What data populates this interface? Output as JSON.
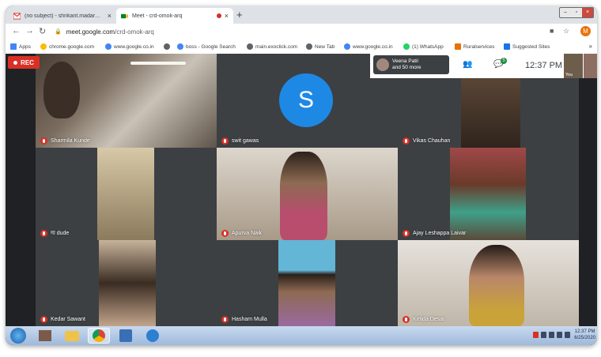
{
  "browser": {
    "tabs": [
      {
        "title": "(no subject) - shrikant.madar@...",
        "active": false
      },
      {
        "title": "Meet - crd-omok-arq",
        "active": true
      }
    ],
    "url_host": "meet.google.com",
    "url_path": "/crd-omok-arq",
    "bookmarks": [
      {
        "label": "Apps",
        "icon": "apps-grid-icon"
      },
      {
        "label": "chrome.google.com",
        "icon": "google-icon"
      },
      {
        "label": "www.google.co.in",
        "icon": "google-icon"
      },
      {
        "label": "",
        "icon": "globe-icon"
      },
      {
        "label": "boss - Google Search",
        "icon": "google-icon"
      },
      {
        "label": "main.exoclick.com",
        "icon": "globe-icon"
      },
      {
        "label": "New Tab",
        "icon": "globe-icon"
      },
      {
        "label": "www.google.co.in",
        "icon": "google-icon"
      },
      {
        "label": "(1) WhatsApp",
        "icon": "whatsapp-icon"
      },
      {
        "label": "Ruralservices",
        "icon": "bookmark-icon"
      },
      {
        "label": "Suggested Sites",
        "icon": "bookmark-icon"
      }
    ],
    "profile_initial": "M"
  },
  "meet": {
    "rec_label": "REC",
    "presenter_name": "Veena Patil",
    "presenter_others": "and 50 more",
    "chat_count": "5",
    "clock": "12:37 PM",
    "self_label": "You",
    "avatar_letter": "S",
    "participants": [
      {
        "name": "Sharmila Kunde"
      },
      {
        "name": "swit gawas"
      },
      {
        "name": "Vikas Chauhan"
      },
      {
        "name": "गा dude"
      },
      {
        "name": "Apurva Naik"
      },
      {
        "name": "Ajay Leshappa Laivar"
      },
      {
        "name": "Kedar Sawant"
      },
      {
        "name": "Hasham Mulla"
      },
      {
        "name": "Kirtida Desai"
      }
    ]
  },
  "taskbar": {
    "time": "12:37 PM",
    "date": "6/25/2020"
  },
  "colors": {
    "meet_bg": "#202124",
    "rec_red": "#d93025",
    "avatar_blue": "#1e88e5",
    "chat_badge_green": "#1e8e3e"
  }
}
